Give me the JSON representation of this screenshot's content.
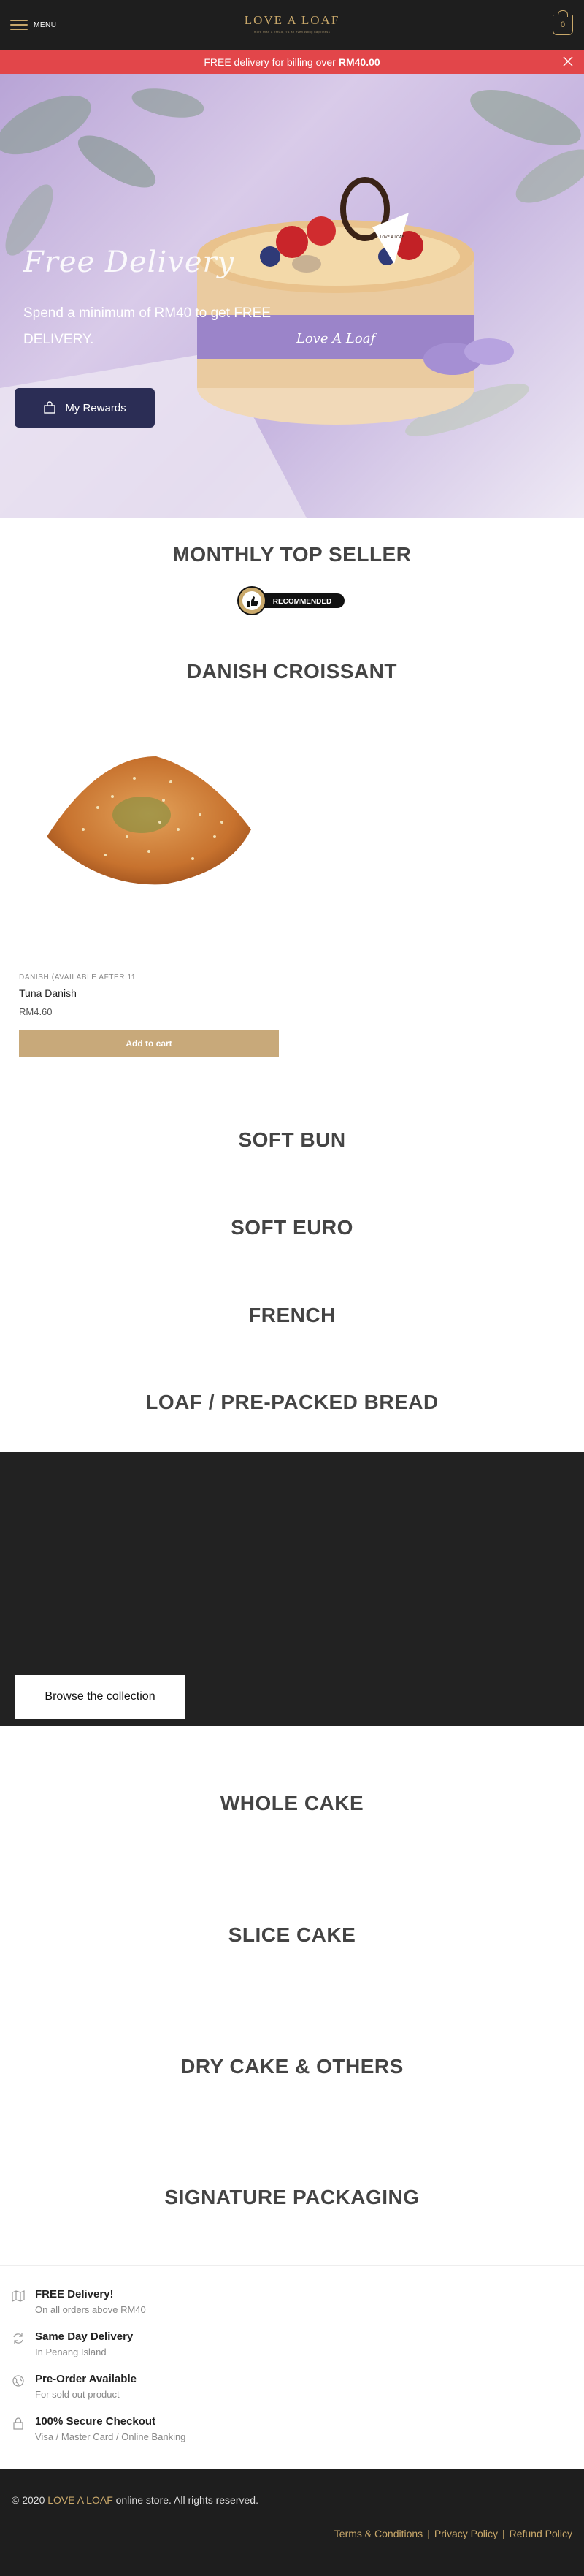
{
  "header": {
    "menu_label": "MENU",
    "logo_title": "LOVE A LOAF",
    "logo_tagline": "more than a bread, it's an everlasting happiness",
    "cart_count": "0"
  },
  "promo": {
    "text": "FREE delivery for billing over",
    "amount": "RM40.00"
  },
  "hero": {
    "cake_band_text": "Love A Loaf",
    "cake_tag_text": "LOVE A LOAF",
    "title": "Free Delivery",
    "subtitle_prefix": "Spend a minimum of RM40 to get ",
    "subtitle_bold": "FREE DELIVERY.",
    "rewards_label": "My Rewards"
  },
  "sections": {
    "monthly_top_seller": "MONTHLY TOP SELLER",
    "badge_label": "RECOMMENDED",
    "danish_croissant": "DANISH CROISSANT",
    "soft_bun": "SOFT BUN",
    "soft_euro": "SOFT EURO",
    "french": "FRENCH",
    "loaf": "LOAF / PRE-PACKED BREAD",
    "whole_cake": "WHOLE CAKE",
    "slice_cake": "SLICE CAKE",
    "dry_cake": "DRY CAKE & OTHERS",
    "signature_packaging": "SIGNATURE PACKAGING"
  },
  "product": {
    "category": "DANISH (AVAILABLE AFTER 11",
    "name": "Tuna Danish",
    "price": "RM4.60",
    "add_to_cart": "Add to cart"
  },
  "banner": {
    "browse_label": "Browse the collection"
  },
  "features": [
    {
      "icon": "map-icon",
      "title": "FREE Delivery!",
      "desc": "On all orders above RM40"
    },
    {
      "icon": "refresh-icon",
      "title": "Same Day Delivery",
      "desc": "In Penang Island"
    },
    {
      "icon": "globe-icon",
      "title": "Pre-Order Available",
      "desc": "For sold out product"
    },
    {
      "icon": "lock-icon",
      "title": "100% Secure Checkout",
      "desc": "Visa / Master Card / Online Banking"
    }
  ],
  "footer": {
    "copyright_prefix": "© 2020",
    "brand": "LOVE A LOAF",
    "copyright_suffix": "online store. All rights reserved.",
    "links": [
      "Terms & Conditions",
      "Privacy Policy",
      "Refund Policy"
    ],
    "separator": "|"
  },
  "colors": {
    "header_bg": "#1e1e1e",
    "accent_gold": "#c9a86a",
    "promo_red": "#e2464a",
    "rewards_btn": "#2b2d55",
    "add_cart_btn": "#c8a97a"
  }
}
